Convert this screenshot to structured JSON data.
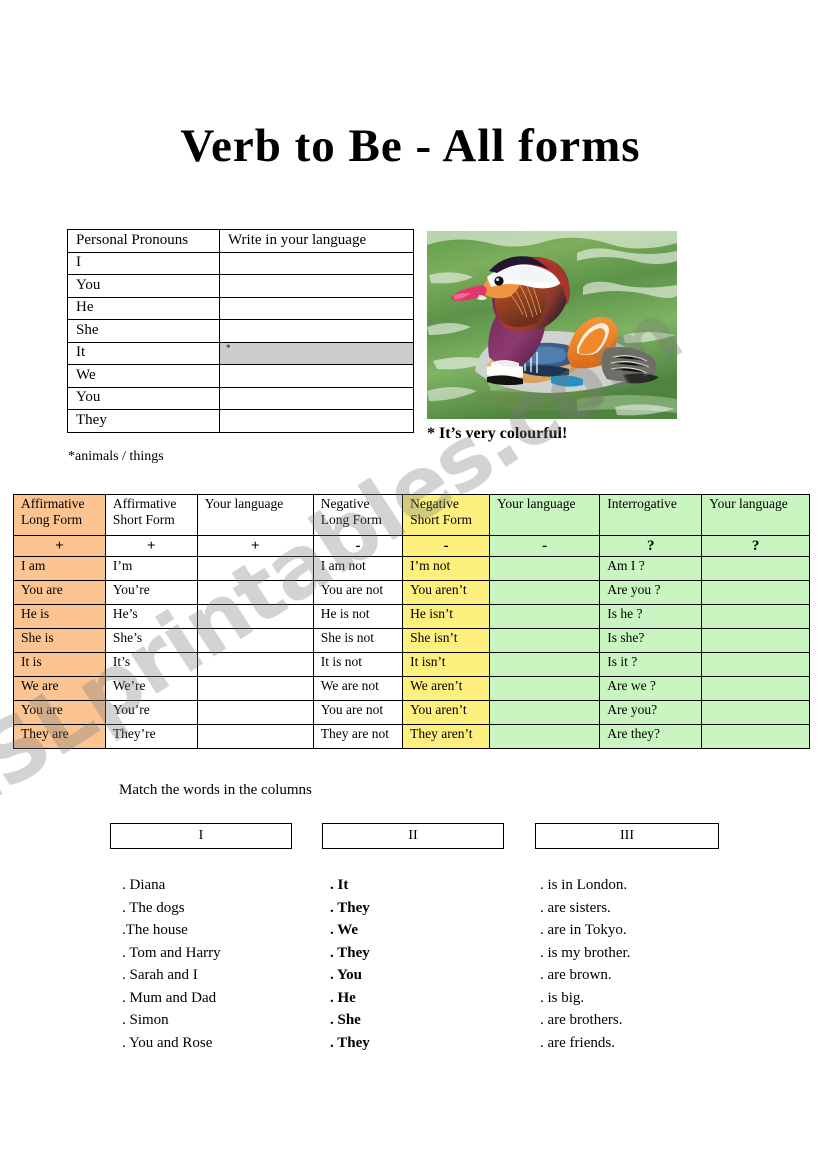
{
  "title": "Verb to Be - All forms",
  "watermark": "ESLprintables.com",
  "pronoun_table": {
    "headers": [
      "Personal Pronouns",
      "Write in your language"
    ],
    "rows": [
      "I",
      "You",
      "He",
      "She",
      "It",
      "We",
      "You",
      "They"
    ],
    "it_cell_marker": "*",
    "note": "*animals / things"
  },
  "photo": {
    "alt": "mandarin-duck-on-water",
    "caption": "* It’s very colourful!"
  },
  "verb_table": {
    "headers": [
      {
        "line1": "Affirmative",
        "line2": "Long Form"
      },
      {
        "line1": "Affirmative",
        "line2": "Short Form"
      },
      {
        "line1": "Your language",
        "line2": ""
      },
      {
        "line1": "Negative",
        "line2": "Long Form"
      },
      {
        "line1": "Negative",
        "line2": "Short Form"
      },
      {
        "line1": "Your language",
        "line2": ""
      },
      {
        "line1": "Interrogative",
        "line2": ""
      },
      {
        "line1": "Your language",
        "line2": ""
      }
    ],
    "symbols": [
      "+",
      "+",
      "+",
      "-",
      "-",
      "-",
      "?",
      "?"
    ],
    "rows": [
      {
        "aff_long": "I am",
        "aff_short": "I’m",
        "your_lang_1": "",
        "neg_long": "I am not",
        "neg_short": "I’m not",
        "your_lang_2": "",
        "interrogative": "Am I ?",
        "your_lang_3": ""
      },
      {
        "aff_long": "You are",
        "aff_short": "You’re",
        "your_lang_1": "",
        "neg_long": "You are not",
        "neg_short": "You aren’t",
        "your_lang_2": "",
        "interrogative": "Are you ?",
        "your_lang_3": ""
      },
      {
        "aff_long": "He is",
        "aff_short": "He’s",
        "your_lang_1": "",
        "neg_long": "He is not",
        "neg_short": "He isn’t",
        "your_lang_2": "",
        "interrogative": "Is he ?",
        "your_lang_3": ""
      },
      {
        "aff_long": "She is",
        "aff_short": "She’s",
        "your_lang_1": "",
        "neg_long": "She is not",
        "neg_short": "She isn’t",
        "your_lang_2": "",
        "interrogative": "Is she?",
        "your_lang_3": ""
      },
      {
        "aff_long": "It is",
        "aff_short": "It’s",
        "your_lang_1": "",
        "neg_long": "It is not",
        "neg_short": "It isn’t",
        "your_lang_2": "",
        "interrogative": "Is it ?",
        "your_lang_3": ""
      },
      {
        "aff_long": "We are",
        "aff_short": "We’re",
        "your_lang_1": "",
        "neg_long": "We are not",
        "neg_short": "We aren’t",
        "your_lang_2": "",
        "interrogative": "Are we ?",
        "your_lang_3": ""
      },
      {
        "aff_long": "You are",
        "aff_short": "You’re",
        "your_lang_1": "",
        "neg_long": "You are not",
        "neg_short": "You aren’t",
        "your_lang_2": "",
        "interrogative": "Are you?",
        "your_lang_3": ""
      },
      {
        "aff_long": "They are",
        "aff_short": "They’re",
        "your_lang_1": "",
        "neg_long": "They are not",
        "neg_short": "They aren’t",
        "your_lang_2": "",
        "interrogative": "Are they?",
        "your_lang_3": ""
      }
    ]
  },
  "match": {
    "instruction": "Match the words in the columns",
    "box_labels": [
      "I",
      "II",
      "III"
    ],
    "column_1": [
      ". Diana",
      ". The dogs",
      ".The house",
      ". Tom and Harry",
      ". Sarah and I",
      ". Mum and Dad",
      ". Simon",
      ". You and Rose"
    ],
    "column_2": [
      ". It",
      ". They",
      ". We",
      ". They",
      ". You",
      ". He",
      ". She",
      ". They"
    ],
    "column_3": [
      ". is in London.",
      ". are sisters.",
      ". are in Tokyo.",
      ". is my brother.",
      ". are brown.",
      ". is big.",
      ". are brothers.",
      ". are friends."
    ]
  },
  "colors": {
    "affirmative_long": "#fbc491",
    "negative_short": "#fdf07f",
    "interrogative_group": "#c9f5c0",
    "gray_cell": "#cccccc"
  }
}
